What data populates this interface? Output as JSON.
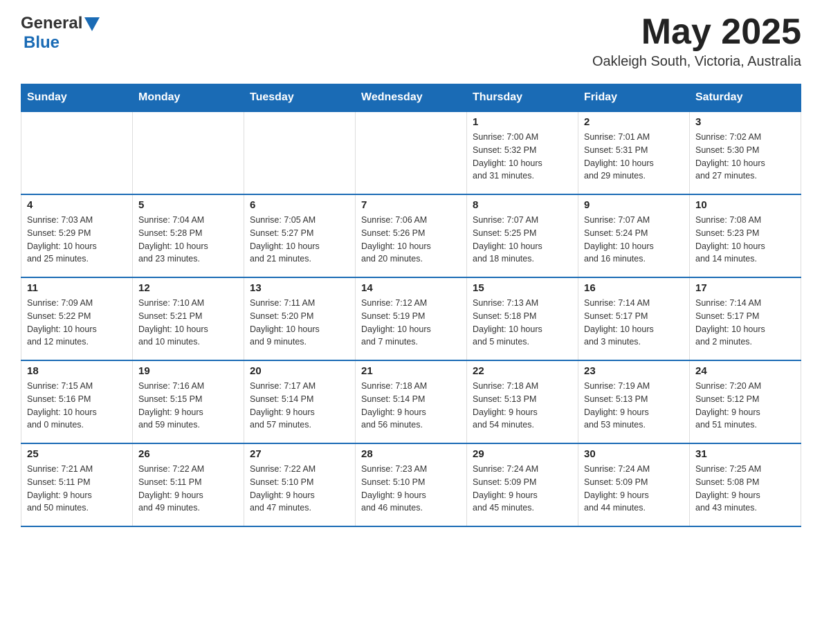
{
  "header": {
    "logo_general": "General",
    "logo_blue": "Blue",
    "month_title": "May 2025",
    "location": "Oakleigh South, Victoria, Australia"
  },
  "weekdays": [
    "Sunday",
    "Monday",
    "Tuesday",
    "Wednesday",
    "Thursday",
    "Friday",
    "Saturday"
  ],
  "weeks": [
    [
      {
        "day": "",
        "info": ""
      },
      {
        "day": "",
        "info": ""
      },
      {
        "day": "",
        "info": ""
      },
      {
        "day": "",
        "info": ""
      },
      {
        "day": "1",
        "info": "Sunrise: 7:00 AM\nSunset: 5:32 PM\nDaylight: 10 hours\nand 31 minutes."
      },
      {
        "day": "2",
        "info": "Sunrise: 7:01 AM\nSunset: 5:31 PM\nDaylight: 10 hours\nand 29 minutes."
      },
      {
        "day": "3",
        "info": "Sunrise: 7:02 AM\nSunset: 5:30 PM\nDaylight: 10 hours\nand 27 minutes."
      }
    ],
    [
      {
        "day": "4",
        "info": "Sunrise: 7:03 AM\nSunset: 5:29 PM\nDaylight: 10 hours\nand 25 minutes."
      },
      {
        "day": "5",
        "info": "Sunrise: 7:04 AM\nSunset: 5:28 PM\nDaylight: 10 hours\nand 23 minutes."
      },
      {
        "day": "6",
        "info": "Sunrise: 7:05 AM\nSunset: 5:27 PM\nDaylight: 10 hours\nand 21 minutes."
      },
      {
        "day": "7",
        "info": "Sunrise: 7:06 AM\nSunset: 5:26 PM\nDaylight: 10 hours\nand 20 minutes."
      },
      {
        "day": "8",
        "info": "Sunrise: 7:07 AM\nSunset: 5:25 PM\nDaylight: 10 hours\nand 18 minutes."
      },
      {
        "day": "9",
        "info": "Sunrise: 7:07 AM\nSunset: 5:24 PM\nDaylight: 10 hours\nand 16 minutes."
      },
      {
        "day": "10",
        "info": "Sunrise: 7:08 AM\nSunset: 5:23 PM\nDaylight: 10 hours\nand 14 minutes."
      }
    ],
    [
      {
        "day": "11",
        "info": "Sunrise: 7:09 AM\nSunset: 5:22 PM\nDaylight: 10 hours\nand 12 minutes."
      },
      {
        "day": "12",
        "info": "Sunrise: 7:10 AM\nSunset: 5:21 PM\nDaylight: 10 hours\nand 10 minutes."
      },
      {
        "day": "13",
        "info": "Sunrise: 7:11 AM\nSunset: 5:20 PM\nDaylight: 10 hours\nand 9 minutes."
      },
      {
        "day": "14",
        "info": "Sunrise: 7:12 AM\nSunset: 5:19 PM\nDaylight: 10 hours\nand 7 minutes."
      },
      {
        "day": "15",
        "info": "Sunrise: 7:13 AM\nSunset: 5:18 PM\nDaylight: 10 hours\nand 5 minutes."
      },
      {
        "day": "16",
        "info": "Sunrise: 7:14 AM\nSunset: 5:17 PM\nDaylight: 10 hours\nand 3 minutes."
      },
      {
        "day": "17",
        "info": "Sunrise: 7:14 AM\nSunset: 5:17 PM\nDaylight: 10 hours\nand 2 minutes."
      }
    ],
    [
      {
        "day": "18",
        "info": "Sunrise: 7:15 AM\nSunset: 5:16 PM\nDaylight: 10 hours\nand 0 minutes."
      },
      {
        "day": "19",
        "info": "Sunrise: 7:16 AM\nSunset: 5:15 PM\nDaylight: 9 hours\nand 59 minutes."
      },
      {
        "day": "20",
        "info": "Sunrise: 7:17 AM\nSunset: 5:14 PM\nDaylight: 9 hours\nand 57 minutes."
      },
      {
        "day": "21",
        "info": "Sunrise: 7:18 AM\nSunset: 5:14 PM\nDaylight: 9 hours\nand 56 minutes."
      },
      {
        "day": "22",
        "info": "Sunrise: 7:18 AM\nSunset: 5:13 PM\nDaylight: 9 hours\nand 54 minutes."
      },
      {
        "day": "23",
        "info": "Sunrise: 7:19 AM\nSunset: 5:13 PM\nDaylight: 9 hours\nand 53 minutes."
      },
      {
        "day": "24",
        "info": "Sunrise: 7:20 AM\nSunset: 5:12 PM\nDaylight: 9 hours\nand 51 minutes."
      }
    ],
    [
      {
        "day": "25",
        "info": "Sunrise: 7:21 AM\nSunset: 5:11 PM\nDaylight: 9 hours\nand 50 minutes."
      },
      {
        "day": "26",
        "info": "Sunrise: 7:22 AM\nSunset: 5:11 PM\nDaylight: 9 hours\nand 49 minutes."
      },
      {
        "day": "27",
        "info": "Sunrise: 7:22 AM\nSunset: 5:10 PM\nDaylight: 9 hours\nand 47 minutes."
      },
      {
        "day": "28",
        "info": "Sunrise: 7:23 AM\nSunset: 5:10 PM\nDaylight: 9 hours\nand 46 minutes."
      },
      {
        "day": "29",
        "info": "Sunrise: 7:24 AM\nSunset: 5:09 PM\nDaylight: 9 hours\nand 45 minutes."
      },
      {
        "day": "30",
        "info": "Sunrise: 7:24 AM\nSunset: 5:09 PM\nDaylight: 9 hours\nand 44 minutes."
      },
      {
        "day": "31",
        "info": "Sunrise: 7:25 AM\nSunset: 5:08 PM\nDaylight: 9 hours\nand 43 minutes."
      }
    ]
  ]
}
